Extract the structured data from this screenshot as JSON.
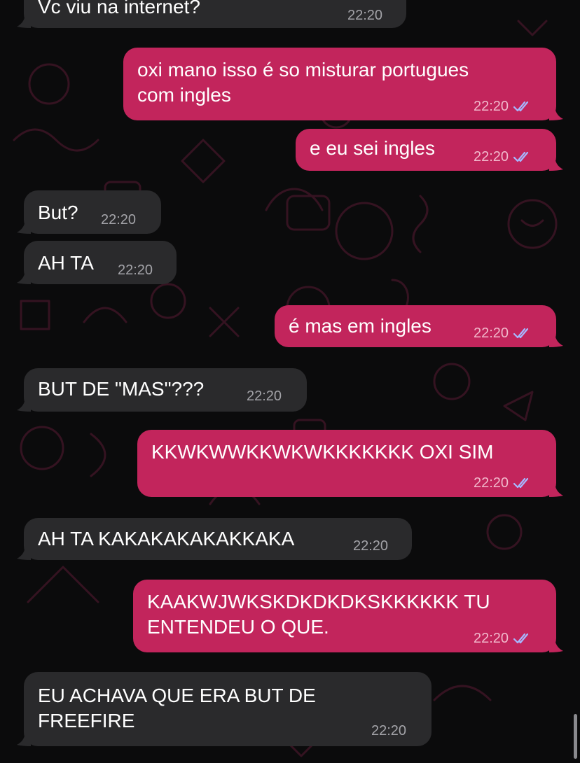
{
  "colors": {
    "background": "#0b0b0c",
    "incoming_bubble": "#2a2a2c",
    "outgoing_bubble": "#c2255c",
    "read_receipt": "#a6b8ff"
  },
  "messages": [
    {
      "direction": "in",
      "text_lines": [
        "Vc viu na internet?"
      ],
      "time": "22:20",
      "read_receipt_icon": null
    },
    {
      "direction": "out",
      "text_lines": [
        "oxi mano isso é so misturar portugues",
        "com ingles"
      ],
      "time": "22:20",
      "read_receipt_icon": "double-check-icon"
    },
    {
      "direction": "out",
      "text_lines": [
        "e eu sei ingles"
      ],
      "time": "22:20",
      "read_receipt_icon": "double-check-icon"
    },
    {
      "direction": "in",
      "text_lines": [
        "But?"
      ],
      "time": "22:20",
      "read_receipt_icon": null
    },
    {
      "direction": "in",
      "text_lines": [
        "AH TA"
      ],
      "time": "22:20",
      "read_receipt_icon": null
    },
    {
      "direction": "out",
      "text_lines": [
        "é mas em ingles"
      ],
      "time": "22:20",
      "read_receipt_icon": "double-check-icon"
    },
    {
      "direction": "in",
      "text_lines": [
        "BUT DE \"MAS\"???"
      ],
      "time": "22:20",
      "read_receipt_icon": null
    },
    {
      "direction": "out",
      "text_lines": [
        "KKWKWWKKWKWKKKKKKK OXI SIM"
      ],
      "time": "22:20",
      "read_receipt_icon": "double-check-icon"
    },
    {
      "direction": "in",
      "text_lines": [
        "AH TA KAKAKAKAKAKKAKA"
      ],
      "time": "22:20",
      "read_receipt_icon": null
    },
    {
      "direction": "out",
      "text_lines": [
        "KAAKWJWKSKDKDKDKSKKKKKK TU",
        "ENTENDEU O QUE."
      ],
      "time": "22:20",
      "read_receipt_icon": "double-check-icon"
    },
    {
      "direction": "in",
      "text_lines": [
        "EU ACHAVA QUE ERA BUT DE",
        "FREEFIRE"
      ],
      "time": "22:20",
      "read_receipt_icon": null
    }
  ]
}
